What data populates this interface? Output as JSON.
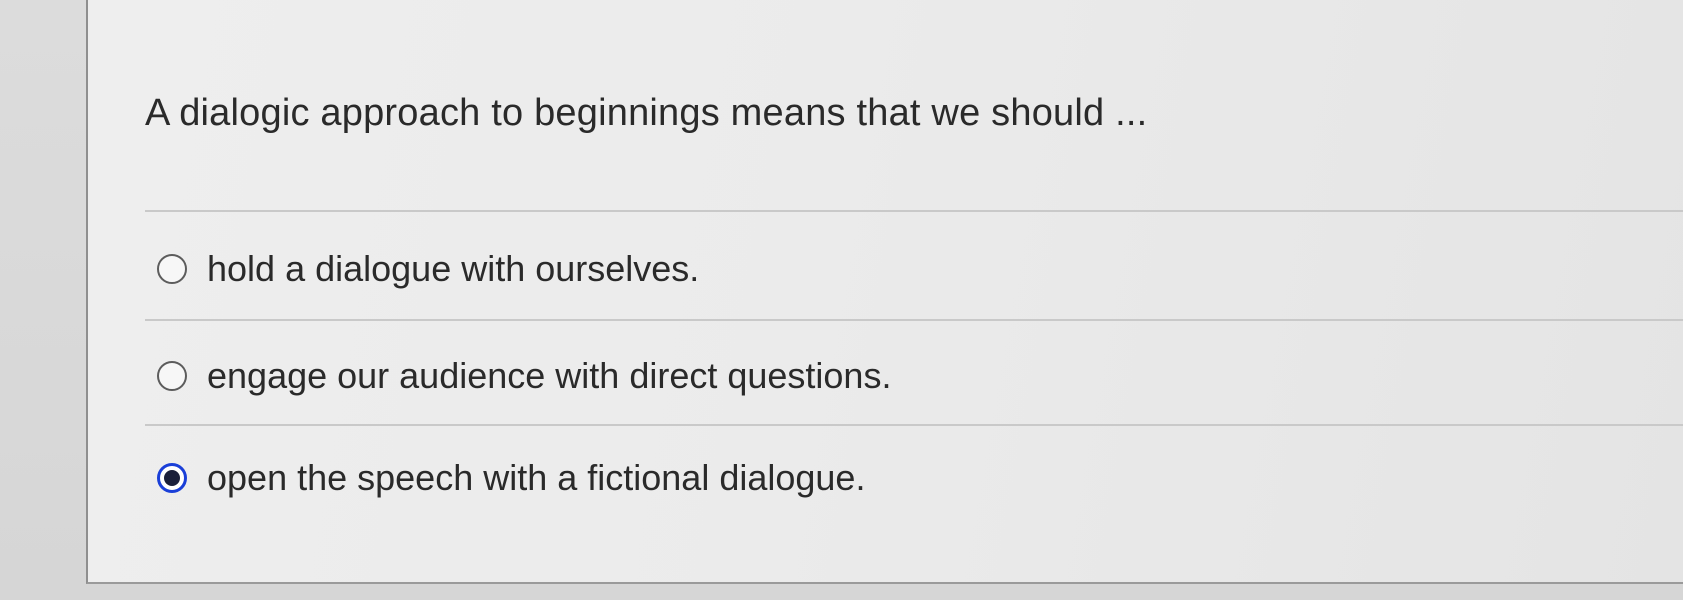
{
  "question": {
    "text": "A dialogic approach to beginnings means that we should ..."
  },
  "options": [
    {
      "label": "hold a dialogue with ourselves.",
      "selected": false
    },
    {
      "label": "engage our audience with direct questions.",
      "selected": false
    },
    {
      "label": "open the speech with a fictional dialogue.",
      "selected": true
    }
  ],
  "colors": {
    "selected_ring": "#1a3fd8",
    "selected_dot": "#1a1f3a",
    "text": "#2a2a2a"
  }
}
